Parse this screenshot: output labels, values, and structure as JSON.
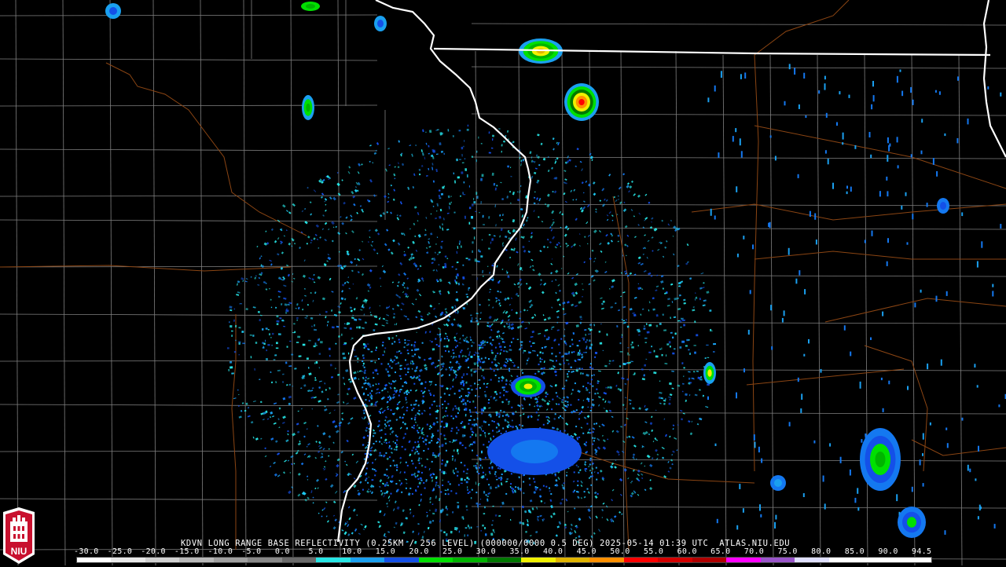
{
  "caption": "KDVN LONG RANGE BASE REFLECTIVITY (0.25KM / 256 LEVEL) (000000/0000 0.5 DEG) 2025-05-14 01:39 UTC  ATLAS.NIU.EDU",
  "logo": {
    "text": "NIU",
    "colors": {
      "red": "#c8102e",
      "white": "#ffffff"
    }
  },
  "color_scale": {
    "labels": [
      "-30.0",
      "-25.0",
      "-20.0",
      "-15.0",
      "-10.0",
      "-5.0",
      "0.0",
      "5.0",
      "10.0",
      "15.0",
      "20.0",
      "25.0",
      "30.0",
      "35.0",
      "40.0",
      "45.0",
      "50.0",
      "55.0",
      "60.0",
      "65.0",
      "70.0",
      "75.0",
      "80.0",
      "85.0",
      "90.0",
      "94.5"
    ],
    "colors": [
      "#ffffff",
      "#e8e8e8",
      "#d0d0d0",
      "#b8b8b8",
      "#a0a0a0",
      "#888888",
      "#6a6a6a",
      "#27e6e6",
      "#1aa0f0",
      "#1450e8",
      "#00e000",
      "#00b400",
      "#007800",
      "#f0f000",
      "#e0b400",
      "#ff9000",
      "#ff0000",
      "#d40000",
      "#b00000",
      "#ff00ff",
      "#9955c9",
      "#e0e0ff",
      "#ffffff",
      "#ffffff",
      "#ffffff"
    ]
  },
  "map": {
    "state_border_color": "#ffffff",
    "county_line_color": "#808080",
    "highway_color": "#8b4513",
    "radar_site": "KDVN"
  }
}
